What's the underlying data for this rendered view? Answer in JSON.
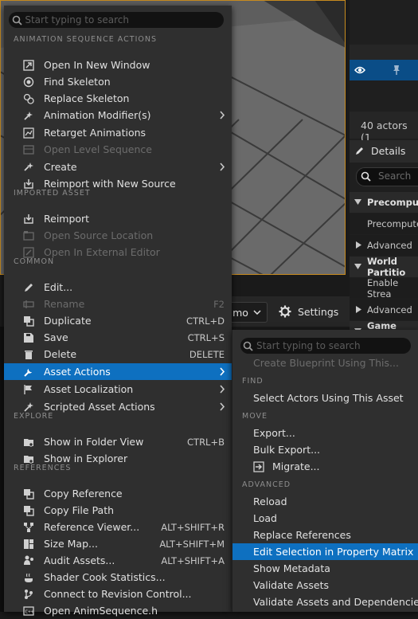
{
  "background": {
    "toolbar": {
      "dropdown_label": "mo",
      "settings_label": "Settings"
    },
    "outliner": {
      "actor_count": "40 actors (1"
    },
    "details": {
      "tab_label": "Details",
      "search_placeholder": "Search",
      "rows": [
        {
          "label": "Precomputed",
          "kind": "hdr",
          "arrow": "down"
        },
        {
          "label": "Precompute",
          "kind": "sub",
          "arrow": ""
        },
        {
          "label": "Advanced",
          "kind": "sub",
          "arrow": "right"
        },
        {
          "label": "World Partitio",
          "kind": "hdr",
          "arrow": "down"
        },
        {
          "label": "Enable Strea",
          "kind": "sub",
          "arrow": ""
        },
        {
          "label": "Advanced",
          "kind": "sub",
          "arrow": "right"
        },
        {
          "label": "Game Mode",
          "kind": "hdr",
          "arrow": "down"
        }
      ]
    }
  },
  "main_menu": {
    "search_placeholder": "Start typing to search",
    "sections": {
      "anim": "ANIMATION SEQUENCE ACTIONS",
      "imported": "IMPORTED ASSET",
      "common": "COMMON",
      "explore": "EXPLORE",
      "references": "REFERENCES"
    },
    "items": [
      {
        "label": "Open In New Window",
        "icon": "open-window-icon",
        "shortcut": "",
        "submenu": false,
        "disabled": false,
        "highlighted": false
      },
      {
        "label": "Find Skeleton",
        "icon": "find-skeleton-icon",
        "shortcut": "",
        "submenu": false,
        "disabled": false,
        "highlighted": false
      },
      {
        "label": "Replace Skeleton",
        "icon": "replace-skeleton-icon",
        "shortcut": "",
        "submenu": false,
        "disabled": false,
        "highlighted": false
      },
      {
        "label": "Animation Modifier(s)",
        "icon": "animation-modifier-icon",
        "shortcut": "",
        "submenu": true,
        "disabled": false,
        "highlighted": false
      },
      {
        "label": "Retarget Animations",
        "icon": "retarget-icon",
        "shortcut": "",
        "submenu": false,
        "disabled": false,
        "highlighted": false
      },
      {
        "label": "Open Level Sequence",
        "icon": "level-sequence-icon",
        "shortcut": "",
        "submenu": false,
        "disabled": true,
        "highlighted": false
      },
      {
        "label": "Create",
        "icon": "create-icon",
        "shortcut": "",
        "submenu": true,
        "disabled": false,
        "highlighted": false
      },
      {
        "label": "Reimport with New Source",
        "icon": "reimport-new-source-icon",
        "shortcut": "",
        "submenu": false,
        "disabled": false,
        "highlighted": false
      },
      {
        "label": "Reimport",
        "icon": "reimport-icon",
        "shortcut": "",
        "submenu": false,
        "disabled": false,
        "highlighted": false
      },
      {
        "label": "Open Source Location",
        "icon": "source-location-icon",
        "shortcut": "",
        "submenu": false,
        "disabled": true,
        "highlighted": false
      },
      {
        "label": "Open In External Editor",
        "icon": "external-editor-icon",
        "shortcut": "",
        "submenu": false,
        "disabled": true,
        "highlighted": false
      },
      {
        "label": "Edit...",
        "icon": "edit-icon",
        "shortcut": "",
        "submenu": false,
        "disabled": false,
        "highlighted": false
      },
      {
        "label": "Rename",
        "icon": "rename-icon",
        "shortcut": "F2",
        "submenu": false,
        "disabled": true,
        "highlighted": false
      },
      {
        "label": "Duplicate",
        "icon": "duplicate-icon",
        "shortcut": "CTRL+D",
        "submenu": false,
        "disabled": false,
        "highlighted": false
      },
      {
        "label": "Save",
        "icon": "save-icon",
        "shortcut": "CTRL+S",
        "submenu": false,
        "disabled": false,
        "highlighted": false
      },
      {
        "label": "Delete",
        "icon": "delete-icon",
        "shortcut": "DELETE",
        "submenu": false,
        "disabled": false,
        "highlighted": false
      },
      {
        "label": "Asset Actions",
        "icon": "asset-actions-icon",
        "shortcut": "",
        "submenu": true,
        "disabled": false,
        "highlighted": true
      },
      {
        "label": "Asset Localization",
        "icon": "asset-localization-icon",
        "shortcut": "",
        "submenu": true,
        "disabled": false,
        "highlighted": false
      },
      {
        "label": "Scripted Asset Actions",
        "icon": "scripted-actions-icon",
        "shortcut": "",
        "submenu": true,
        "disabled": false,
        "highlighted": false
      },
      {
        "label": "Show in Folder View",
        "icon": "folder-view-icon",
        "shortcut": "CTRL+B",
        "submenu": false,
        "disabled": false,
        "highlighted": false
      },
      {
        "label": "Show in Explorer",
        "icon": "explorer-icon",
        "shortcut": "",
        "submenu": false,
        "disabled": false,
        "highlighted": false
      },
      {
        "label": "Copy Reference",
        "icon": "copy-reference-icon",
        "shortcut": "",
        "submenu": false,
        "disabled": false,
        "highlighted": false
      },
      {
        "label": "Copy File Path",
        "icon": "copy-file-path-icon",
        "shortcut": "",
        "submenu": false,
        "disabled": false,
        "highlighted": false
      },
      {
        "label": "Reference Viewer...",
        "icon": "reference-viewer-icon",
        "shortcut": "ALT+SHIFT+R",
        "submenu": false,
        "disabled": false,
        "highlighted": false
      },
      {
        "label": "Size Map...",
        "icon": "size-map-icon",
        "shortcut": "ALT+SHIFT+M",
        "submenu": false,
        "disabled": false,
        "highlighted": false
      },
      {
        "label": "Audit Assets...",
        "icon": "audit-assets-icon",
        "shortcut": "ALT+SHIFT+A",
        "submenu": false,
        "disabled": false,
        "highlighted": false
      },
      {
        "label": "Shader Cook Statistics...",
        "icon": "shader-cook-icon",
        "shortcut": "",
        "submenu": false,
        "disabled": false,
        "highlighted": false
      },
      {
        "label": "Connect to Revision Control...",
        "icon": "revision-control-icon",
        "shortcut": "",
        "submenu": false,
        "disabled": false,
        "highlighted": false
      },
      {
        "label": "Open AnimSequence.h",
        "icon": "cpp-file-icon",
        "shortcut": "",
        "submenu": false,
        "disabled": false,
        "highlighted": false
      }
    ]
  },
  "sub_menu": {
    "search_placeholder": "Start typing to search",
    "sections": {
      "find": "FIND",
      "move": "MOVE",
      "advanced": "ADVANCED"
    },
    "items": [
      {
        "label": "Create Blueprint Using This...",
        "disabled": true,
        "highlighted": false,
        "icon": ""
      },
      {
        "label": "Select Actors Using This Asset",
        "disabled": false,
        "highlighted": false,
        "icon": ""
      },
      {
        "label": "Export...",
        "disabled": false,
        "highlighted": false,
        "icon": ""
      },
      {
        "label": "Bulk Export...",
        "disabled": false,
        "highlighted": false,
        "icon": ""
      },
      {
        "label": "Migrate...",
        "disabled": false,
        "highlighted": false,
        "icon": "migrate-icon"
      },
      {
        "label": "Reload",
        "disabled": false,
        "highlighted": false,
        "icon": ""
      },
      {
        "label": "Load",
        "disabled": false,
        "highlighted": false,
        "icon": ""
      },
      {
        "label": "Replace References",
        "disabled": false,
        "highlighted": false,
        "icon": ""
      },
      {
        "label": "Edit Selection in Property Matrix",
        "disabled": false,
        "highlighted": true,
        "icon": ""
      },
      {
        "label": "Show Metadata",
        "disabled": false,
        "highlighted": false,
        "icon": ""
      },
      {
        "label": "Validate Assets",
        "disabled": false,
        "highlighted": false,
        "icon": ""
      },
      {
        "label": "Validate Assets and Dependencies",
        "disabled": false,
        "highlighted": false,
        "icon": ""
      }
    ]
  }
}
